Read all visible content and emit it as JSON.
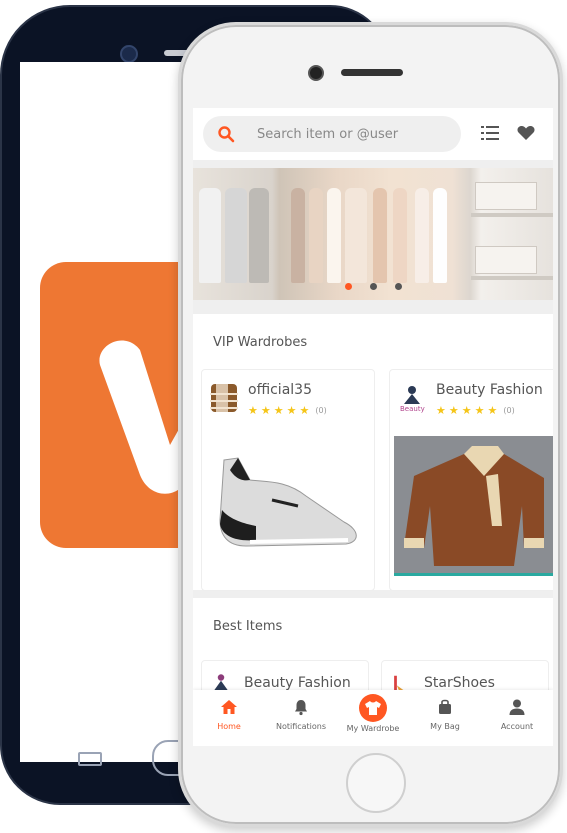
{
  "app": {
    "brand_color": "#ff5722",
    "logo_color": "#ee7733"
  },
  "search": {
    "placeholder": "Search item or @user",
    "icon": "search-icon"
  },
  "header_icons": [
    "list-icon",
    "heart-icon"
  ],
  "banner": {
    "slide_count": 3,
    "active_slide": 1
  },
  "vip": {
    "title": "VIP Wardrobes",
    "cards": [
      {
        "name": "official35",
        "rating": 5,
        "count": "(0)",
        "image": "sneaker"
      },
      {
        "name": "Beauty Fashion",
        "rating": 5,
        "count": "(0)",
        "image": "leather-jacket"
      }
    ]
  },
  "best": {
    "title": "Best Items",
    "cards": [
      {
        "name": "Beauty Fashion"
      },
      {
        "name": "StarShoes"
      }
    ]
  },
  "nav": {
    "items": [
      {
        "label": "Home",
        "icon": "home-icon",
        "active": true
      },
      {
        "label": "Notifications",
        "icon": "bell-icon",
        "active": false
      },
      {
        "label": "My Wardrobe",
        "icon": "tshirt-icon",
        "active": false
      },
      {
        "label": "My Bag",
        "icon": "bag-icon",
        "active": false
      },
      {
        "label": "Account",
        "icon": "user-icon",
        "active": false
      }
    ]
  }
}
